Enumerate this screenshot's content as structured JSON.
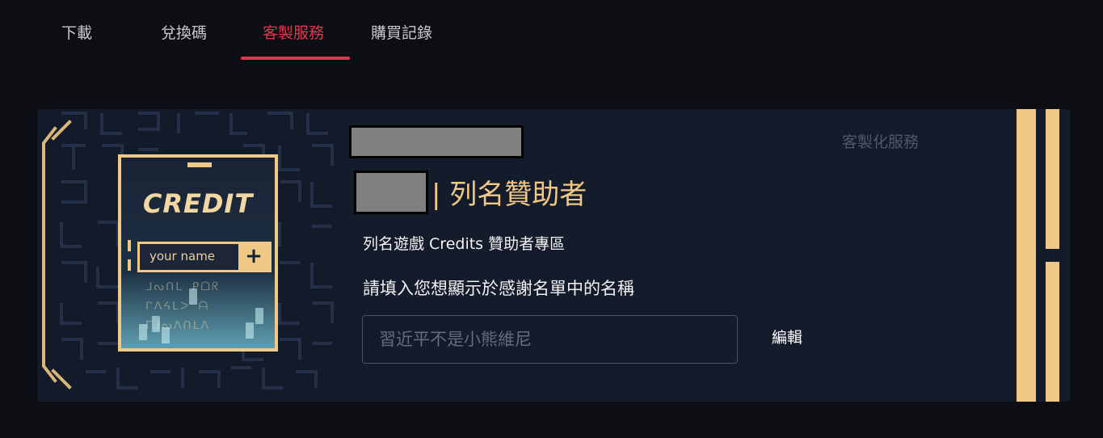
{
  "tabs": [
    {
      "label": "下載",
      "active": false
    },
    {
      "label": "兌換碼",
      "active": false
    },
    {
      "label": "客製服務",
      "active": true
    },
    {
      "label": "購買記錄",
      "active": false
    }
  ],
  "card": {
    "illustration": {
      "title": "CREDIT",
      "name_placeholder": "your name",
      "plus": "+"
    },
    "sponsor_title": "| 列名贊助者",
    "service_label": "客製化服務",
    "description": "列名遊戲 Credits 贊助者專區",
    "prompt": "請填入您想顯示於感謝名單中的名稱",
    "name_input": {
      "placeholder": "習近平不是小熊維尼",
      "value": ""
    },
    "edit_label": "編輯"
  },
  "colors": {
    "background": "#0d0e13",
    "card": "#141b2b",
    "accent_red": "#e2354f",
    "accent_gold": "#f0c987"
  }
}
